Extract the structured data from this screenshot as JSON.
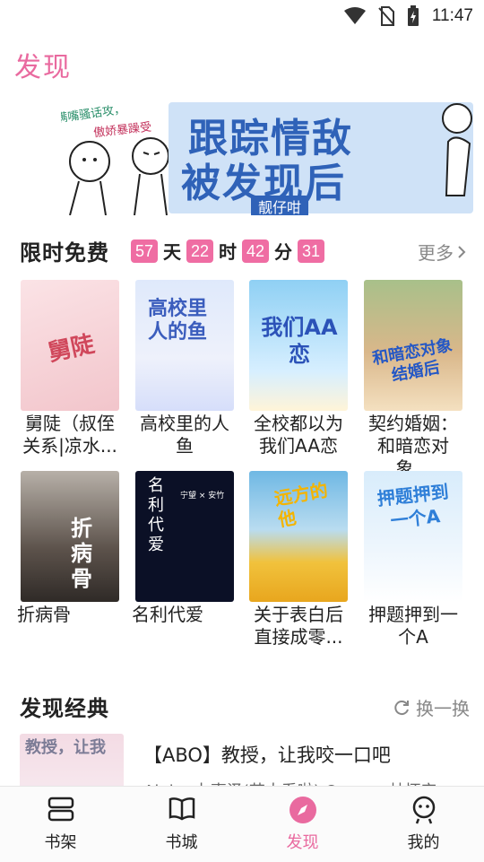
{
  "status": {
    "time": "11:47"
  },
  "page": {
    "title": "发现"
  },
  "banner": {
    "line1": "跟踪情敌",
    "line2": "被发现后",
    "tag": "靓仔咁",
    "doodle1": "满嘴骚话攻，",
    "doodle2": "傲娇暴躁受"
  },
  "limited": {
    "title": "限时免费",
    "countdown": {
      "days": "57",
      "days_unit": "天",
      "hours": "22",
      "hours_unit": "时",
      "minutes": "42",
      "minutes_unit": "分",
      "seconds": "31"
    },
    "more": "更多",
    "books": [
      {
        "title": "舅陡（叔侄关系|凉水...",
        "cover_text": "舅陡"
      },
      {
        "title": "高校里的人鱼",
        "cover_text": "高校里人的鱼"
      },
      {
        "title": "全校都以为我们AA恋",
        "cover_text": "我们AA恋"
      },
      {
        "title": "契约婚姻：和暗恋对象...",
        "cover_text": "和暗恋对象结婚后"
      },
      {
        "title": "折病骨",
        "cover_text": "折病骨"
      },
      {
        "title": "名利代爱",
        "cover_text": "名利代爱",
        "cover_sub": "宁望 × 安竹"
      },
      {
        "title": "关于表白后直接成零...",
        "cover_text": "远方的他"
      },
      {
        "title": "押题押到一个A",
        "cover_text": "押题押到一个A"
      }
    ]
  },
  "classic": {
    "title": "发现经典",
    "refresh": "换一换",
    "item": {
      "title": "【ABO】教授，让我咬一口吧",
      "subtitle": "Alpha 办事泽(苗大乔啦) Omega 林怀安",
      "cover_text": "教授，让我"
    }
  },
  "tabs": [
    {
      "label": "书架",
      "icon": "bookshelf-icon"
    },
    {
      "label": "书城",
      "icon": "open-book-icon"
    },
    {
      "label": "发现",
      "icon": "compass-icon",
      "active": true
    },
    {
      "label": "我的",
      "icon": "profile-icon"
    }
  ],
  "colors": {
    "accent": "#e96a9f",
    "countdown_bg": "#ef6da3",
    "banner_blue": "#2f62b8"
  }
}
